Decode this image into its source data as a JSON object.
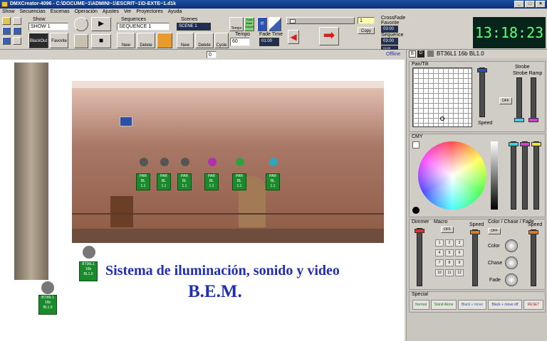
{
  "window": {
    "title": "DMXCreator-4096 - C:\\DOCUME~1\\ADMINI~1\\ESCRIT~1\\D-EXTE~1.d1k"
  },
  "menu": [
    "Show",
    "Secuencias",
    "Escenas",
    "Operación",
    "Ajustes",
    "Ver",
    "Proyectores",
    "Ayuda"
  ],
  "toolbar": {
    "show_label": "Show",
    "show_value": "SHOW 1",
    "blackout": "BlackOut",
    "favorite": "Favorite",
    "sequences_label": "Sequences",
    "sequence_value": "SEQUENCE 1",
    "scenes_label": "Scenes",
    "scene_value": "SCENE 1",
    "new1": "New",
    "delete1": "Delete",
    "new2": "New",
    "delete2": "Delete",
    "cycle": "Cycle",
    "tempo_label": "Tempo",
    "tempo_value": "60",
    "fade_label": "Fade Time",
    "fade_value": "01:00",
    "copy": "Copy",
    "counter": "1",
    "crossfade_label": "CrossFade",
    "favorite_label": "Favorite",
    "crossfade_value": "03:00",
    "sequence_small": "Sequence",
    "sequence_time": "03:00",
    "aux_value": "01:00",
    "clock": "13:18:23",
    "tempo_btn": "Tempo",
    "tempo_btn2": "Tnsfc Mark Sound"
  },
  "toolbar2": {
    "counter": "0",
    "offline": "Offline"
  },
  "stage": {
    "fixtures": [
      {
        "line1": "PAR",
        "line2": "BL",
        "line3": "1.1"
      },
      {
        "line1": "PAR",
        "line2": "BL",
        "line3": "1.1"
      },
      {
        "line1": "PAR",
        "line2": "BL",
        "line3": "1.1"
      },
      {
        "line1": "PAR",
        "line2": "BL",
        "line3": "1.1"
      },
      {
        "line1": "PAR",
        "line2": "BL",
        "line3": "1.1"
      },
      {
        "line1": "PAR",
        "line2": "BL",
        "line3": "1.1"
      }
    ],
    "head1": {
      "line1": "BT36L1",
      "line2": "16b",
      "line3": "BL1.0"
    },
    "head2": {
      "line1": "BT36L1",
      "line2": "16b",
      "line3": "BL1.0"
    },
    "caption1": "Sistema de iluminación, sonido y video",
    "caption2": "B.E.M."
  },
  "panel": {
    "badge_b": "B",
    "badge_d": "D",
    "fixture_name": "BT36L1 16b BL1.0",
    "pantilt": "Pan/Tilt",
    "speed": "Speed",
    "strobe": "Strobe",
    "strobe_ramp": "Strobe Ramp",
    "off": "OFF",
    "cmy": "CMY",
    "dimmer": "Dimmer",
    "macro": "Macro",
    "macro_off": "OFF",
    "speed2": "Speed",
    "speed3": "Speed",
    "color_group": "Color / Chase / Fade",
    "color_off": "OFF",
    "color": "Color",
    "chase": "Chase",
    "fade": "Fade",
    "keys": [
      "1",
      "2",
      "3",
      "4",
      "5",
      "6",
      "7",
      "8",
      "9",
      "10",
      "11",
      "12"
    ],
    "special": "Special",
    "special_btns": [
      "Normal",
      "Stand Alone",
      "Black + move",
      "Black + move off",
      "RESET"
    ]
  }
}
